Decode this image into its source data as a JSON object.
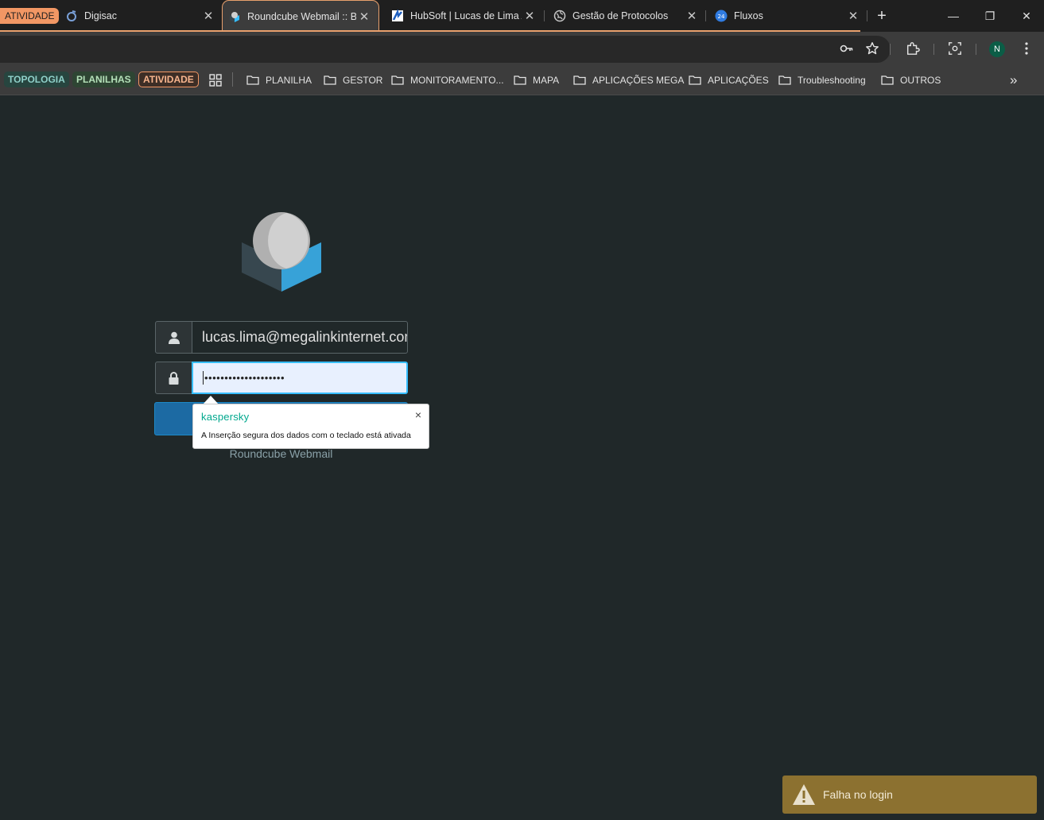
{
  "tabs": {
    "group_label": "ATIVIDADE",
    "items": [
      {
        "title": "Digisac"
      },
      {
        "title": "Roundcube Webmail :: Bem-vindo",
        "active": true
      },
      {
        "title": "HubSoft | Lucas de Lima Alves"
      },
      {
        "title": "Gestão de Protocolos"
      },
      {
        "title": "Fluxos"
      }
    ],
    "new_tab_symbol": "+"
  },
  "window_controls": {
    "minimize": "—",
    "restore": "❐",
    "close": "✕"
  },
  "toolbar": {
    "profile_initial": "N"
  },
  "bookmarks": {
    "chips": [
      "TOPOLOGIA",
      "PLANILHAS",
      "ATIVIDADE"
    ],
    "folders": [
      "PLANILHA",
      "GESTOR",
      "MONITORAMENTO...",
      "MAPA",
      "APLICAÇÕES MEGA",
      "APLICAÇÕES",
      "Troubleshooting",
      "OUTROS"
    ],
    "overflow_symbol": "»"
  },
  "login": {
    "username_value": "lucas.lima@megalinkinternet.com.br",
    "password_mask": "••••••••••••••••••••",
    "footer_text": "Roundcube Webmail"
  },
  "kaspersky": {
    "brand": "kaspersky",
    "message": "A Inserção segura dos dados com o teclado está ativada",
    "close_symbol": "×"
  },
  "toast": {
    "message": "Falha no login"
  },
  "colors": {
    "page_bg": "#202829",
    "accent_orange": "#e8a06d",
    "kaspersky_green": "#00a88e",
    "toast_bg": "#8c7130",
    "submit_bg": "#1c6aa3"
  }
}
